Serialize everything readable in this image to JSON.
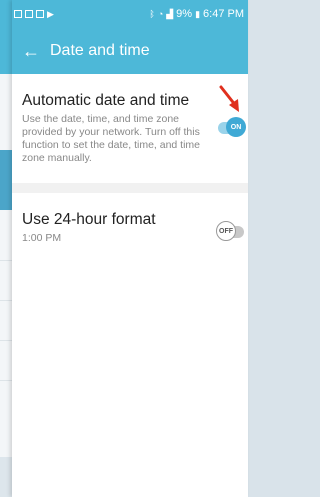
{
  "status_bar": {
    "battery": "9%",
    "time": "6:47 PM"
  },
  "header": {
    "title": "Date and time"
  },
  "settings": [
    {
      "title": "Automatic date and time",
      "description": "Use the date, time, and time zone provided by your network. Turn off this function to set the date, time, and time zone manually.",
      "toggle": "ON"
    },
    {
      "title": "Use 24-hour format",
      "subtitle": "1:00 PM",
      "toggle": "OFF"
    }
  ],
  "colors": {
    "accent": "#4db8d8",
    "toggle_on": "#3fa9d5",
    "arrow": "#e0301e"
  },
  "icons": [
    "back-arrow-icon",
    "bluetooth-icon",
    "wifi-icon",
    "signal-icon",
    "battery-icon"
  ]
}
